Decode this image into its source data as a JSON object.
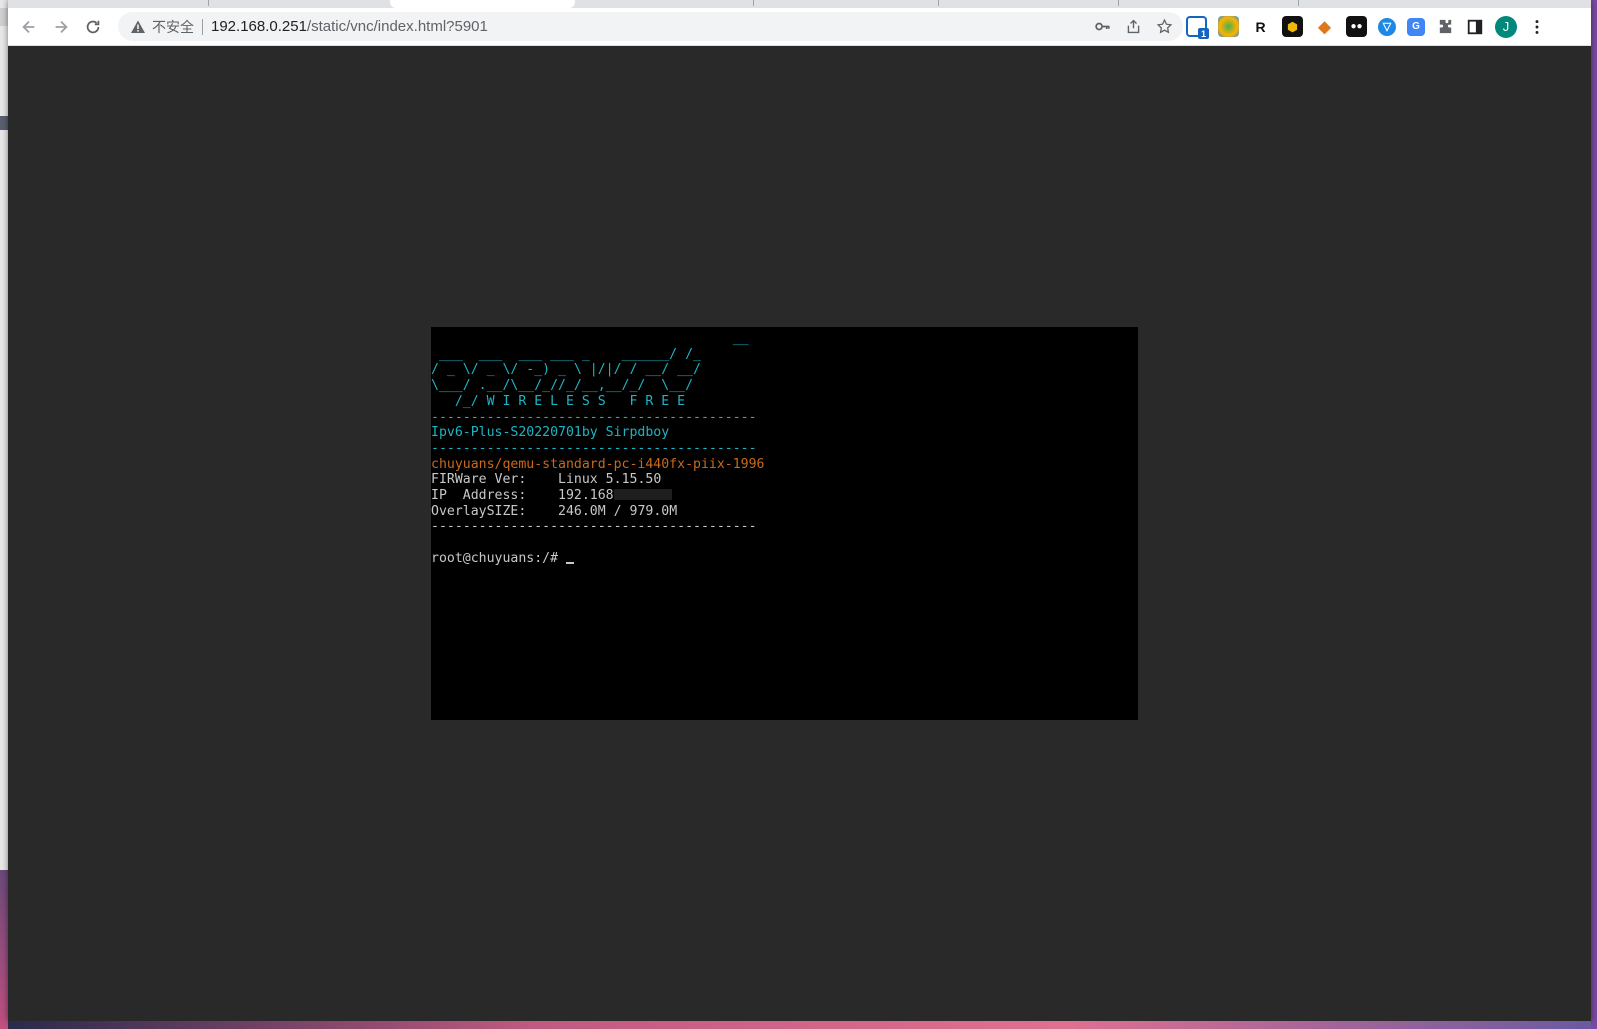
{
  "browser": {
    "security_label": "不安全",
    "url_host": "192.168.0.251",
    "url_path": "/static/vnc/index.html?5901",
    "profile_initial": "J",
    "extension_badge": "1",
    "extension_r_label": "R"
  },
  "terminal": {
    "logo_lines": [
      "                                      __",
      " ___  ___  ___ ___ _    ______/ /_",
      "/ _ \\/ _ \\/ -_) _ \\ |/|/ / __/ __/",
      "\\___/ .__/\\__/_//_/__,__/_/  \\__/",
      "   /_/ W I R E L E S S   F R E E"
    ],
    "separator": "-----------------------------------------",
    "version_line": "Ipv6-Plus-S20220701by Sirpdboy",
    "model_line": "chuyuans/qemu-standard-pc-i440fx-piix-1996",
    "firmware_label": "FIRWare Ver:",
    "firmware_value": "Linux 5.15.50",
    "ip_label": "IP  Address:",
    "ip_value": "192.168",
    "overlay_label": "OverlaySIZE:",
    "overlay_value": "246.0M / 979.0M",
    "prompt": "root@chuyuans:/# "
  },
  "colors": {
    "terminal_cyan": "#1cb5c4",
    "terminal_orange": "#c86a1a",
    "viewport_bg": "#292929"
  }
}
